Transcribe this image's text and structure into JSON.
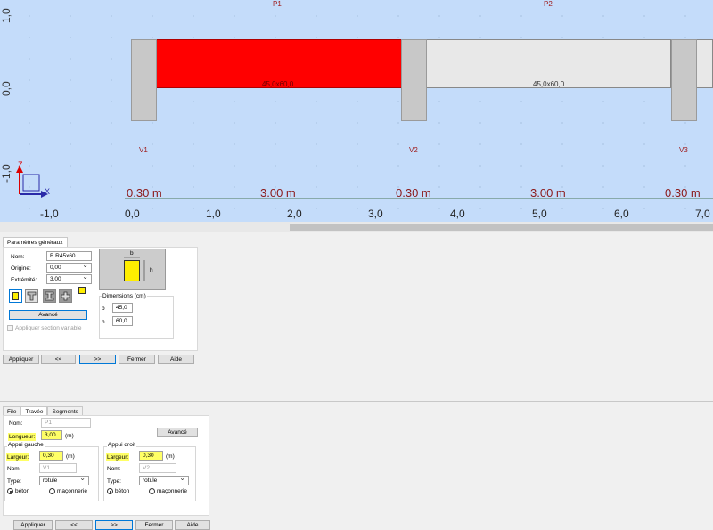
{
  "canvas": {
    "y_ticks": [
      "1,0",
      "0,0",
      "-1,0"
    ],
    "x_ticks": [
      "-1,0",
      "0,0",
      "1,0",
      "2,0",
      "3,0",
      "4,0",
      "5,0",
      "6,0",
      "7,0"
    ],
    "beam_tags": [
      "P1",
      "P2"
    ],
    "support_tags": [
      "V1",
      "V2",
      "V3"
    ],
    "beam_labels": [
      "45,0x60,0",
      "45,0x60,0"
    ],
    "dimensions": [
      "0.30 m",
      "3.00 m",
      "0.30 m",
      "3.00 m",
      "0.30 m"
    ],
    "axis_z": "Z",
    "axis_x": "X",
    "colors": {
      "selected_beam": "#ff0000",
      "beam": "#e8e8e8",
      "pillar": "#c8c8c8",
      "canvas_bg": "#c4dcfa"
    }
  },
  "section_panel": {
    "tab": "Paramètres généraux",
    "nom_label": "Nom:",
    "nom_value": "B R45x60",
    "origine_label": "Origine:",
    "origine_value": "0,00",
    "extremite_label": "Extrémité:",
    "extremite_value": "3,00",
    "avance_label": "Avancé",
    "variable_label": "Appliquer section variable",
    "preview_b": "b",
    "preview_h": "h",
    "dimensions_title": "Dimensions (cm)",
    "b_label": "b",
    "b_value": "45,0",
    "h_label": "h",
    "h_value": "60,0",
    "buttons": [
      "Appliquer",
      "<<",
      ">>",
      "Fermer",
      "Aide"
    ]
  },
  "span_panel": {
    "tabs": [
      "File",
      "Travée",
      "Segments"
    ],
    "nom_label": "Nom:",
    "nom_value": "P1",
    "avance_label": "Avancé",
    "longueur_label": "Longueur:",
    "longueur_value": "3,00",
    "unit_m": "(m)",
    "left_title": "Appui gauche",
    "right_title": "Appui droit",
    "largeur_label": "Largeur:",
    "left_largeur": "0,30",
    "right_largeur": "0,30",
    "left_nom": "V1",
    "right_nom": "V2",
    "type_label": "Type:",
    "left_type": "rotule",
    "right_type": "rotule",
    "beton_label": "béton",
    "maconnerie_label": "maçonnerie",
    "buttons": [
      "Appliquer",
      "<<",
      ">>",
      "Fermer",
      "Aide"
    ]
  }
}
